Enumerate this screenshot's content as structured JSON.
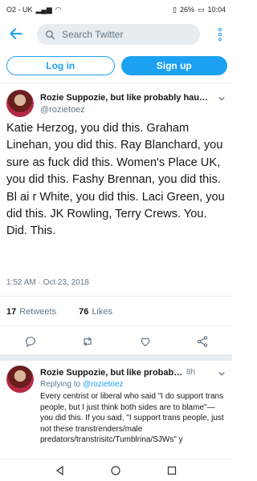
{
  "status": {
    "carrier": "O2 - UK",
    "battery": "26%",
    "time": "10:04"
  },
  "search": {
    "placeholder": "Search Twitter"
  },
  "auth": {
    "login": "Log in",
    "signup": "Sign up"
  },
  "tweet": {
    "author": "Rozie Suppozie, but like probably haun...",
    "handle": "@rozietoez",
    "text": "Katie Herzog, you did this. Graham Linehan, you did this. Ray Blanchard, you sure as fuck did this. Women's Place UK, you did this. Fashy Brennan, you did this. Bl ai r White, you did this. Laci Green, you did this. JK Rowling, Terry Crews. You. Did. This.",
    "timestamp": "1:52 AM · Oct 23, 2018",
    "retweets_count": "17",
    "retweets_label": "Retweets",
    "likes_count": "76",
    "likes_label": "Likes"
  },
  "reply": {
    "author": "Rozie Suppozie, but like probably ...",
    "time": "8h",
    "replying_prefix": "Replying to ",
    "replying_handle": "@rozietoez",
    "text": "Every centrist or liberal who said \"I do support trans people, but I just think both sides are to blame\"—you did this. If you said, \"I support trans people, just not these transtrenders/male predators/transtrisitc/Tumblrina/SJWs\" y"
  },
  "icons": [
    "back-arrow-icon",
    "search-icon",
    "more-icon",
    "caret-down-icon",
    "reply-icon",
    "retweet-icon",
    "like-icon",
    "share-icon",
    "nav-back-icon",
    "nav-home-icon",
    "nav-recents-icon"
  ],
  "colors": {
    "accent": "#1da1f2",
    "muted": "#657786",
    "divider": "#e6ecf0"
  }
}
